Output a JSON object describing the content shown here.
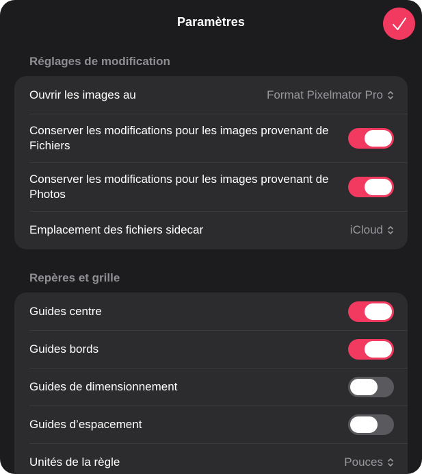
{
  "header": {
    "title": "Paramètres",
    "done_icon": "checkmark-icon"
  },
  "colors": {
    "accent": "#f2395f",
    "background": "#1c1c1e",
    "group_bg": "#2c2c2e",
    "secondary_text": "#8e8e93"
  },
  "sections": [
    {
      "header": "Réglages de modification",
      "rows": [
        {
          "label": "Ouvrir les images au",
          "type": "picker",
          "value": "Format Pixelmator Pro"
        },
        {
          "label": "Conserver les modifications pour les images provenant de Fichiers",
          "type": "toggle",
          "on": true
        },
        {
          "label": "Conserver les modifications pour les images provenant de Photos",
          "type": "toggle",
          "on": true
        },
        {
          "label": "Emplacement des fichiers sidecar",
          "type": "picker",
          "value": "iCloud"
        }
      ]
    },
    {
      "header": "Repères et grille",
      "rows": [
        {
          "label": "Guides centre",
          "type": "toggle",
          "on": true
        },
        {
          "label": "Guides bords",
          "type": "toggle",
          "on": true
        },
        {
          "label": "Guides de dimensionnement",
          "type": "toggle",
          "on": false
        },
        {
          "label": "Guides d’espacement",
          "type": "toggle",
          "on": false
        },
        {
          "label": "Unités de la règle",
          "type": "picker",
          "value": "Pouces"
        }
      ]
    }
  ]
}
